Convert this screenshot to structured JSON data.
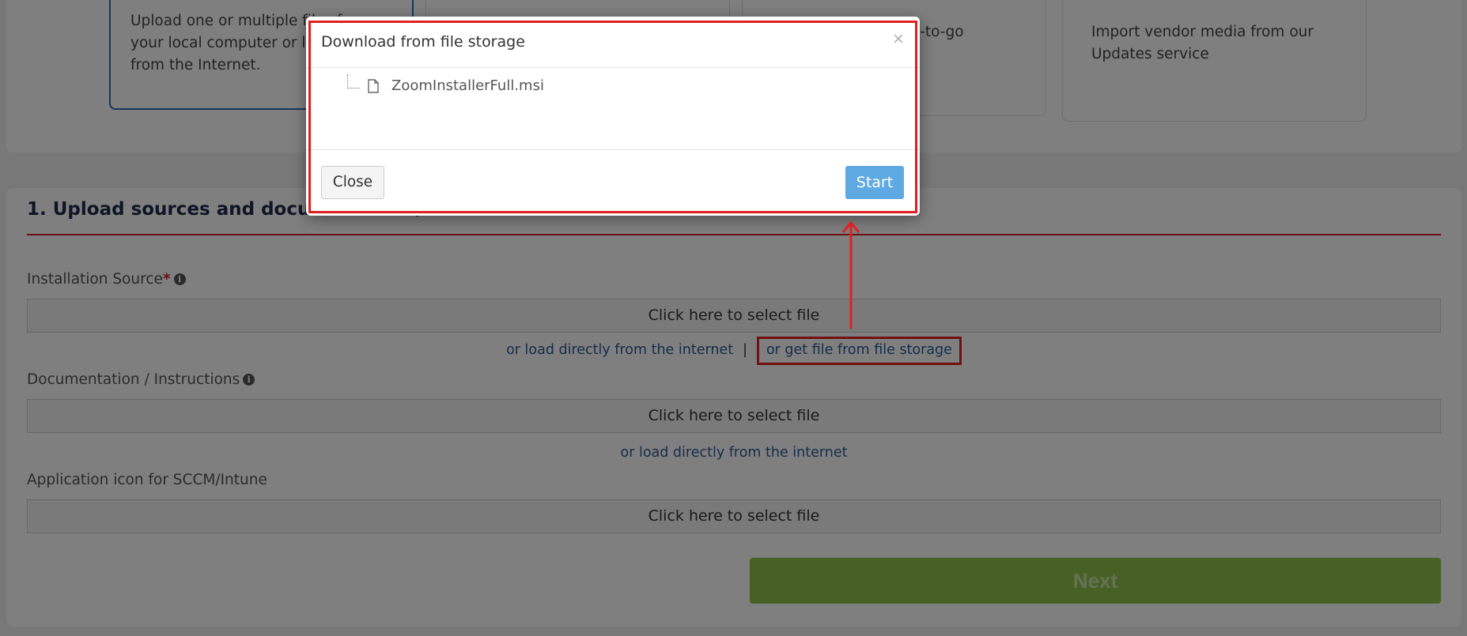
{
  "cards": {
    "upload_card_text": "Upload one or multiple files from\nyour local computer or load them\nfrom the Internet.",
    "catalogue_card_text": "Order from our ready-to-go\nCatalogue service",
    "updates_card_text": "Import vendor media from our\nUpdates service"
  },
  "section": {
    "title": "1. Upload sources and documentation/instructions",
    "installation_source": {
      "label": "Installation Source",
      "required_marker": "*",
      "select_text": "Click here to select file",
      "load_link": "or load directly from the internet",
      "separator": "|",
      "storage_link": "or get file from file storage"
    },
    "documentation": {
      "label": "Documentation / Instructions",
      "select_text": "Click here to select file",
      "load_link": "or load directly from the internet"
    },
    "app_icon": {
      "label": "Application icon for SCCM/Intune",
      "select_text": "Click here to select file"
    },
    "next_label": "Next"
  },
  "modal": {
    "title": "Download from file storage",
    "close_x": "×",
    "files": [
      "ZoomInstallerFull.msi"
    ],
    "close_label": "Close",
    "start_label": "Start"
  },
  "info_glyph": "i",
  "colors": {
    "accent_red": "#d2222f",
    "annotation_red": "#e02020",
    "link_blue": "#2c5a93",
    "start_blue": "#5fa9e3",
    "next_green": "#8fc24a",
    "selected_border": "#2c6fbf"
  }
}
